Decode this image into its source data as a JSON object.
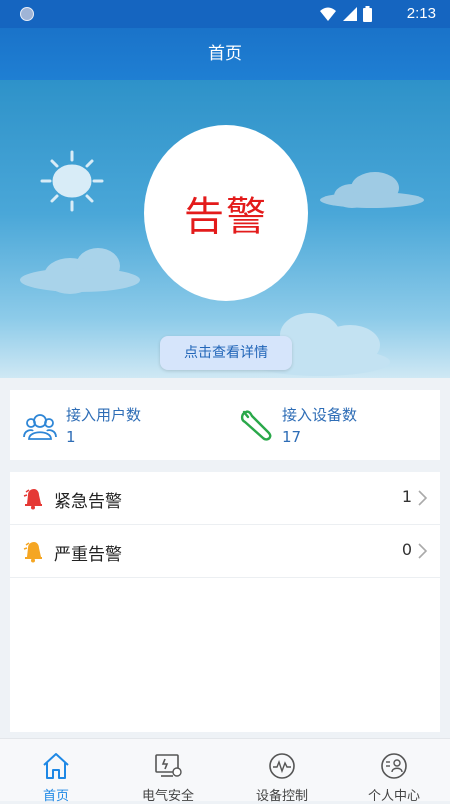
{
  "status_bar": {
    "time": "2:13"
  },
  "header": {
    "title": "首页"
  },
  "hero": {
    "status_text": "告警",
    "detail_button": "点击查看详情"
  },
  "stats": [
    {
      "label": "接入用户数",
      "value": "1",
      "icon": "users-icon"
    },
    {
      "label": "接入设备数",
      "value": "17",
      "icon": "wrench-icon"
    }
  ],
  "alarms": [
    {
      "label": "紧急告警",
      "count": "1",
      "icon": "red-bell-icon",
      "color": "#e53935"
    },
    {
      "label": "严重告警",
      "count": "0",
      "icon": "orange-bell-icon",
      "color": "#f5a623"
    }
  ],
  "nav": [
    {
      "label": "首页",
      "icon": "home-icon",
      "active": true
    },
    {
      "label": "电气安全",
      "icon": "electrical-safety-icon",
      "active": false
    },
    {
      "label": "设备控制",
      "icon": "device-control-icon",
      "active": false
    },
    {
      "label": "个人中心",
      "icon": "profile-icon",
      "active": false
    }
  ],
  "colors": {
    "primary": "#1e88e5",
    "alarm_red": "#e31b1b",
    "stat_blue": "#2e6db6"
  }
}
